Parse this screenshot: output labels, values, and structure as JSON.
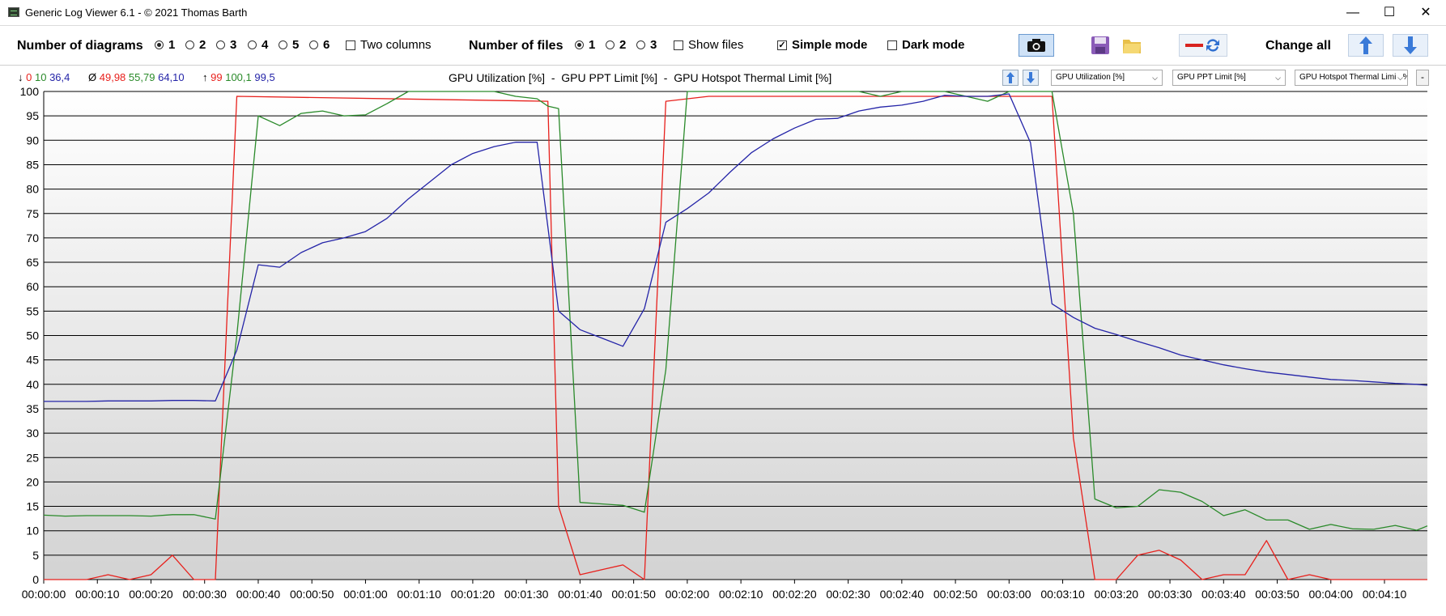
{
  "window": {
    "title": "Generic Log Viewer 6.1 - © 2021 Thomas Barth",
    "minimize": "—",
    "maximize": "☐",
    "close": "✕"
  },
  "toolbar": {
    "diagrams_label": "Number of diagrams",
    "diagram_options": [
      "1",
      "2",
      "3",
      "4",
      "5",
      "6"
    ],
    "diagrams_selected": "1",
    "two_columns_label": "Two columns",
    "two_columns_checked": false,
    "files_label": "Number of files",
    "file_options": [
      "1",
      "2",
      "3"
    ],
    "files_selected": "1",
    "show_files_label": "Show files",
    "show_files_checked": false,
    "simple_mode_label": "Simple mode",
    "simple_mode_checked": true,
    "dark_mode_label": "Dark mode",
    "dark_mode_checked": false,
    "change_all_label": "Change all",
    "icons": [
      "camera-icon",
      "save-icon",
      "folder-icon",
      "remove-icon",
      "refresh-icon",
      "arrow-up-icon",
      "arrow-down-icon"
    ]
  },
  "stats": {
    "min_arrow": "↓",
    "min_values": [
      "0",
      "10",
      "36,4"
    ],
    "avg_symbol": "Ø",
    "avg_values": [
      "49,98",
      "55,79",
      "64,10"
    ],
    "max_arrow": "↑",
    "max_values": [
      "99",
      "100,1",
      "99,5"
    ]
  },
  "chart_header": {
    "title": "GPU Utilization [%]  -  GPU PPT Limit [%]  -  GPU Hotspot Thermal Limit [%]",
    "combos": [
      "GPU Utilization [%]",
      "GPU PPT Limit [%]",
      "GPU Hotspot Thermal Limit [%]"
    ],
    "remove_label": "-"
  },
  "colors": {
    "utilization": "#e8201c",
    "ppt": "#2a8a2a",
    "hotspot": "#2424a8",
    "accent": "#3a7ad8"
  },
  "chart_data": {
    "type": "line",
    "ylim": [
      0,
      100
    ],
    "yticks": [
      "0",
      "5",
      "10",
      "15",
      "20",
      "25",
      "30",
      "35",
      "40",
      "45",
      "50",
      "55",
      "60",
      "65",
      "70",
      "75",
      "80",
      "85",
      "90",
      "95",
      "100"
    ],
    "xticks": [
      "00:00:00",
      "00:00:10",
      "00:00:20",
      "00:00:30",
      "00:00:40",
      "00:00:50",
      "00:01:00",
      "00:01:10",
      "00:01:20",
      "00:01:30",
      "00:01:40",
      "00:01:50",
      "00:02:00",
      "00:02:10",
      "00:02:20",
      "00:02:30",
      "00:02:40",
      "00:02:50",
      "00:03:00",
      "00:03:10",
      "00:03:20",
      "00:03:30",
      "00:03:40",
      "00:03:50",
      "00:04:00",
      "00:04:10"
    ],
    "xlim": [
      0,
      258
    ],
    "grid": true,
    "series": [
      {
        "color": "#e8201c",
        "x": [
          0,
          4,
          8,
          12,
          16,
          20,
          24,
          28,
          32,
          36,
          94,
          96,
          100,
          104,
          108,
          112,
          116,
          124,
          128,
          132,
          140,
          150,
          160,
          170,
          180,
          188,
          192,
          196,
          200,
          204,
          208,
          212,
          216,
          220,
          224,
          228,
          232,
          236,
          240,
          244,
          248,
          252,
          258
        ],
        "y": [
          0,
          0,
          0,
          1,
          0,
          1,
          5,
          0,
          0,
          99,
          98,
          15,
          1,
          2,
          3,
          0,
          98,
          99,
          99,
          99,
          99,
          99,
          99,
          99,
          99,
          99,
          29,
          0,
          0,
          5,
          6,
          4,
          0,
          1,
          1,
          8,
          0,
          1,
          0,
          0,
          0,
          0,
          0
        ]
      },
      {
        "color": "#2a8a2a",
        "x": [
          0,
          4,
          8,
          12,
          16,
          20,
          24,
          28,
          32,
          36,
          40,
          44,
          48,
          52,
          56,
          60,
          64,
          68,
          72,
          76,
          80,
          84,
          88,
          92,
          94,
          96,
          100,
          104,
          108,
          112,
          116,
          120,
          124,
          128,
          132,
          136,
          140,
          144,
          148,
          152,
          156,
          160,
          164,
          168,
          172,
          176,
          180,
          184,
          188,
          192,
          196,
          200,
          204,
          208,
          212,
          216,
          220,
          224,
          228,
          232,
          236,
          240,
          244,
          248,
          252,
          256,
          258
        ],
        "y": [
          13.2,
          13,
          13.1,
          13.1,
          13.1,
          13,
          13.3,
          13.3,
          12.4,
          50,
          95,
          93,
          95.5,
          96,
          95,
          95.2,
          97.5,
          100,
          100,
          100,
          100,
          100,
          99,
          98.5,
          97,
          96.5,
          15.8,
          15.5,
          15.2,
          13.8,
          43,
          100,
          100,
          100,
          100,
          100,
          100,
          100,
          100,
          100,
          99,
          100,
          100,
          100,
          99,
          98,
          100,
          100,
          100,
          75,
          16.5,
          14.7,
          15,
          18.4,
          17.9,
          16,
          13.1,
          14.3,
          12.2,
          12.2,
          10.3,
          11.3,
          10.4,
          10.3,
          11.1,
          10.1,
          11
        ]
      },
      {
        "color": "#2424a8",
        "x": [
          0,
          4,
          8,
          12,
          16,
          20,
          24,
          28,
          32,
          36,
          40,
          44,
          48,
          52,
          56,
          60,
          64,
          68,
          72,
          76,
          80,
          84,
          88,
          92,
          96,
          100,
          104,
          108,
          112,
          116,
          120,
          124,
          128,
          132,
          136,
          140,
          144,
          148,
          152,
          156,
          160,
          164,
          168,
          172,
          176,
          180,
          184,
          188,
          192,
          196,
          200,
          204,
          208,
          212,
          216,
          220,
          224,
          228,
          232,
          236,
          240,
          244,
          248,
          252,
          256,
          258
        ],
        "y": [
          36.5,
          36.5,
          36.5,
          36.6,
          36.6,
          36.6,
          36.7,
          36.7,
          36.6,
          47,
          64.5,
          64,
          67,
          69,
          70,
          71.3,
          74,
          78,
          81.5,
          85,
          87.3,
          88.7,
          89.6,
          89.6,
          55,
          51.2,
          49.5,
          47.8,
          55.5,
          73.2,
          76,
          79.2,
          83.5,
          87.5,
          90.3,
          92.5,
          94.3,
          94.5,
          96,
          96.8,
          97.2,
          98,
          99.2,
          99,
          99,
          99.5,
          89.5,
          56.5,
          53.7,
          51.5,
          50.2,
          48.8,
          47.5,
          46,
          45,
          44,
          43.2,
          42.5,
          42,
          41.5,
          41,
          40.8,
          40.5,
          40.2,
          40,
          39.8
        ]
      }
    ]
  }
}
